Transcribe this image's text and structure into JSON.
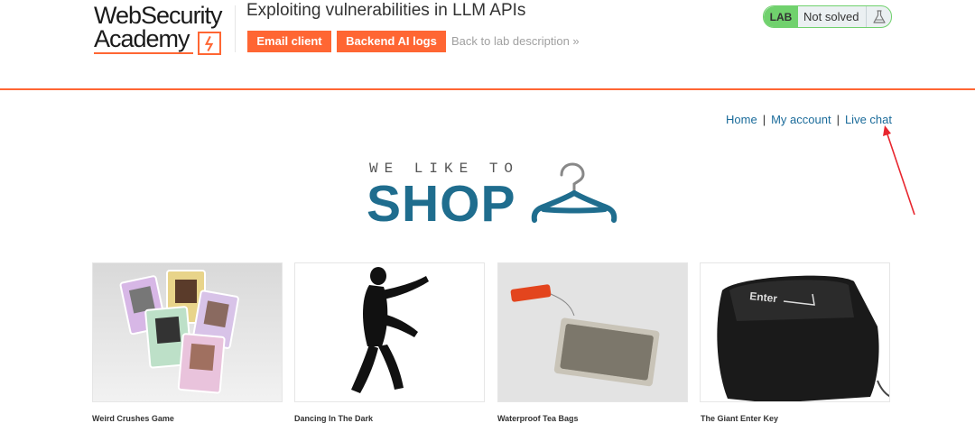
{
  "header": {
    "logo": {
      "line1": "WebSecurity",
      "line2": "Academy"
    },
    "lab_title": "Exploiting vulnerabilities in LLM APIs",
    "email_client_label": "Email client",
    "backend_ai_logs_label": "Backend AI logs",
    "back_link_label": "Back to lab description »",
    "status": {
      "badge": "LAB",
      "text": "Not solved",
      "icon": "flask-icon"
    }
  },
  "nav": {
    "home": "Home",
    "separator": "|",
    "my_account": "My account",
    "live_chat": "Live chat"
  },
  "banner": {
    "tagline": "WE LIKE TO",
    "word": "SHOP",
    "icon": "hanger-icon"
  },
  "products": [
    {
      "name": "Weird Crushes Game"
    },
    {
      "name": "Dancing In The Dark"
    },
    {
      "name": "Waterproof Tea Bags"
    },
    {
      "name": "The Giant Enter Key"
    }
  ],
  "colors": {
    "accent": "#ff6633",
    "lab_green": "#70d16d",
    "link_blue": "#1a6b9a",
    "shop_blue": "#1f6d8e",
    "annotation_red": "#e8262e"
  }
}
